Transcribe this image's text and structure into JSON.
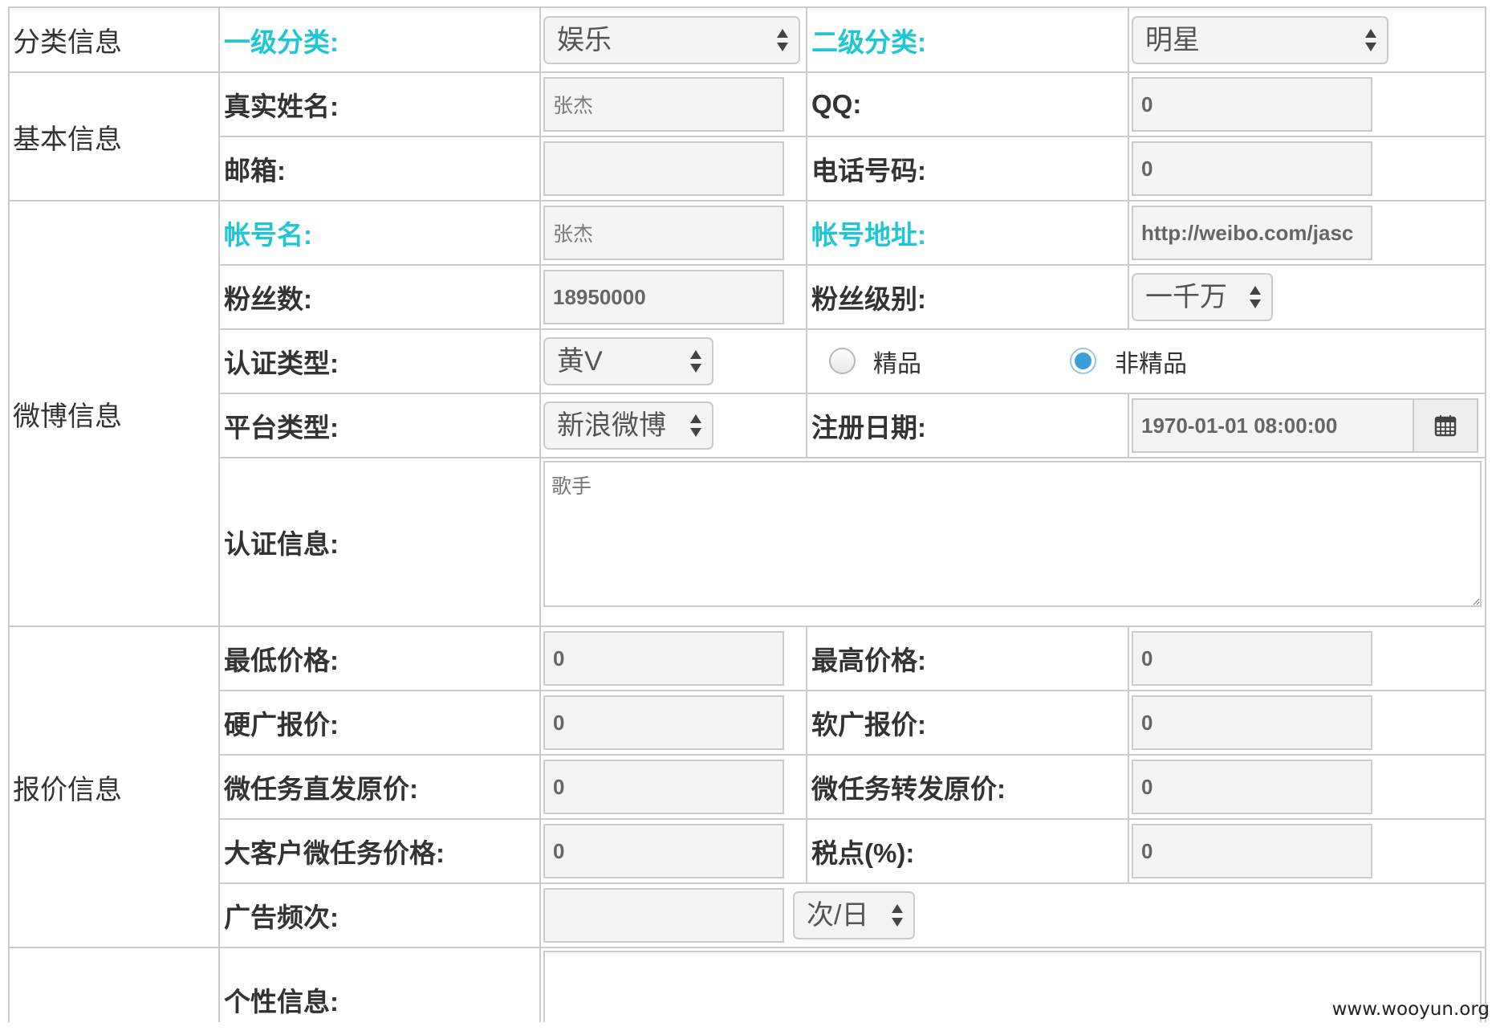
{
  "colors": {
    "accent": "#1fc6d3",
    "text": "#333333",
    "border": "#cccccc",
    "field_bg": "#f4f4f4",
    "radio_checked": "#3a9fd8"
  },
  "icons": {
    "select_arrows": "updown-arrows-icon",
    "date_picker": "calendar-icon"
  },
  "sections": {
    "category": {
      "title": "分类信息",
      "level1": {
        "label": "一级分类:",
        "value": "娱乐"
      },
      "level2": {
        "label": "二级分类:",
        "value": "明星"
      }
    },
    "basic": {
      "title": "基本信息",
      "real_name": {
        "label": "真实姓名:",
        "value": "张杰"
      },
      "qq": {
        "label": "QQ:",
        "value": "0"
      },
      "email": {
        "label": "邮箱:",
        "value": ""
      },
      "phone": {
        "label": "电话号码:",
        "value": "0"
      }
    },
    "weibo": {
      "title": "微博信息",
      "account_name": {
        "label": "帐号名:",
        "value": "张杰"
      },
      "account_url": {
        "label": "帐号地址:",
        "value": "http://weibo.com/jasc"
      },
      "fans": {
        "label": "粉丝数:",
        "value": "18950000"
      },
      "fans_level": {
        "label": "粉丝级别:",
        "value": "一千万"
      },
      "verify_type": {
        "label": "认证类型:",
        "value": "黄V"
      },
      "quality": [
        {
          "label": "精品",
          "checked": false
        },
        {
          "label": "非精品",
          "checked": true
        }
      ],
      "platform": {
        "label": "平台类型:",
        "value": "新浪微博"
      },
      "register_date": {
        "label": "注册日期:",
        "value": "1970-01-01 08:00:00"
      },
      "verify_info": {
        "label": "认证信息:",
        "value": "歌手"
      }
    },
    "pricing": {
      "title": "报价信息",
      "min_price": {
        "label": "最低价格:",
        "value": "0"
      },
      "max_price": {
        "label": "最高价格:",
        "value": "0"
      },
      "hard_ad": {
        "label": "硬广报价:",
        "value": "0"
      },
      "soft_ad": {
        "label": "软广报价:",
        "value": "0"
      },
      "micro_direct": {
        "label": "微任务直发原价:",
        "value": "0"
      },
      "micro_repost": {
        "label": "微任务转发原价:",
        "value": "0"
      },
      "big_client": {
        "label": "大客户微任务价格:",
        "value": "0"
      },
      "tax": {
        "label": "税点(%):",
        "value": "0"
      },
      "ad_frequency": {
        "label": "广告频次:",
        "value": "",
        "unit": "次/日"
      }
    },
    "personal": {
      "label": "个性信息:",
      "value": ""
    }
  },
  "watermark": "www.wooyun.org"
}
